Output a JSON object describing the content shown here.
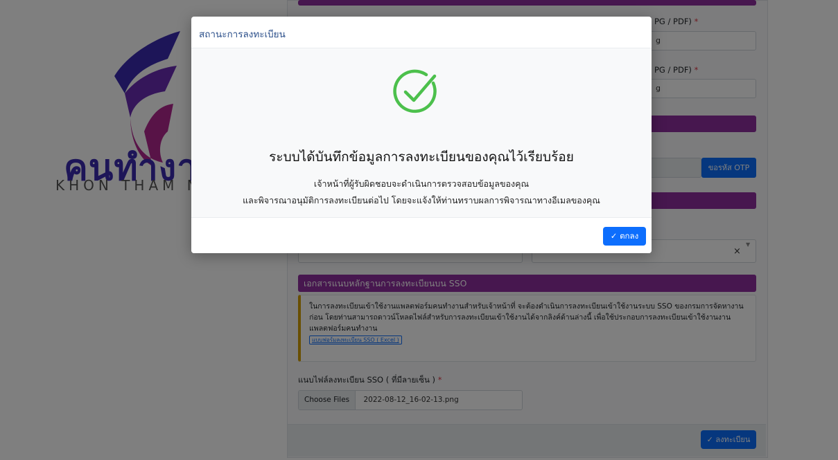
{
  "logo": {
    "word": "คนทำงา",
    "subtitle": "KHON THAM N",
    "colors": {
      "indigo": "#3b2bb0",
      "magenta": "#b0278f"
    }
  },
  "form": {
    "upload_label_1": "PG / PDF)",
    "upload_value_1": "g",
    "upload_label_2": "PG / PDF)",
    "upload_value_2": "g",
    "request_otp_button": "ขอรหัส OTP",
    "clear_symbol": "×",
    "section_sso_title": "เอกสารแนบหลักฐานการลงทะเบียนบน SSO",
    "alert_text": "ในการลงทะเบียนเข้าใช้งานแพลตฟอร์มคนทำงานสำหรับเจ้าหน้าที่ จะต้องดำเนินการลงทะเบียนเข้าใช้งานระบบ SSO ของกรมการจัดหางาน ก่อน โดยท่านสามารถดาวน์โหลดไฟล์สำหรับการลงทะเบียนเข้าใช้งานได้จากลิงค์ด้านล่างนี้ เพื่อใช้ประกอบการลงทะเบียนเข้าใช้งานงาน แพลตฟอร์มคนทำงาน",
    "alert_link": "แบบฟอร์มลงทะเบียน SSO ( Excel )",
    "sso_file_label": "แนบไฟล์ลงทะเบียน SSO ( ที่มีลายเซ็น )",
    "required_mark": "*",
    "choose_files": "Choose Files",
    "file_name": "2022-08-12_16-02-13.png",
    "register_button": "ลงทะเบียน",
    "accent_purple": "#8e2e9e",
    "accent_blue": "#0d6efd"
  },
  "modal": {
    "title": "สถานะการลงทะเบียน",
    "heading": "ระบบได้บันทึกข้อมูลการลงทะเบียนของคุณไว้เรียบร้อย",
    "line1": "เจ้าหน้าที่ผู้รับผิดชอบจะดำเนินการตรวจสอบข้อมูลของคุณ",
    "line2": "และพิจารณาอนุมัติการลงทะเบียนต่อไป โดยจะแจ้งให้ท่านทราบผลการพิจารณาทางอีเมลของคุณ",
    "ok_button": "ตกลง",
    "icon": "check-circle-icon",
    "success_color": "#4cc04c"
  }
}
